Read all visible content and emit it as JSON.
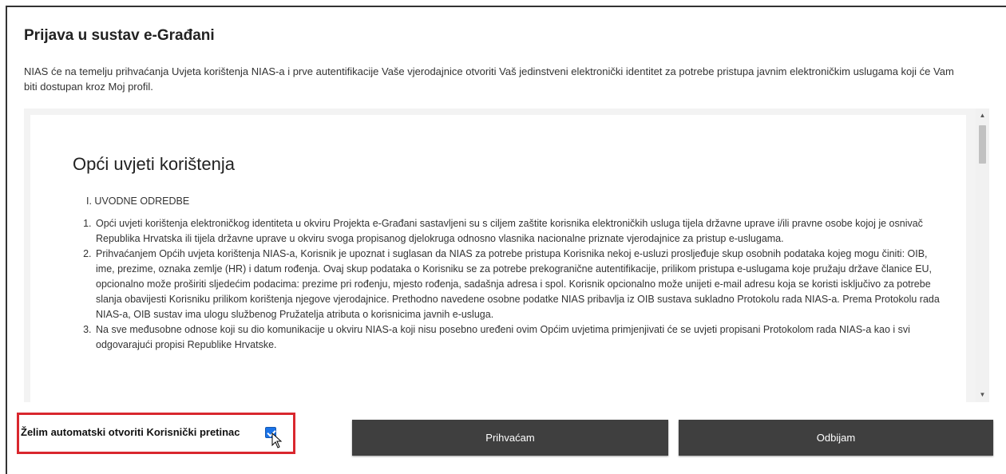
{
  "page": {
    "title": "Prijava u sustav e-Građani",
    "intro": "NIAS će na temelju prihvaćanja Uvjeta korištenja NIAS-a i prve autentifikacije Vaše vjerodajnice otvoriti Vaš jedinstveni elektronički identitet za potrebe pristupa javnim elektroničkim uslugama koji će Vam biti dostupan kroz Moj profil."
  },
  "terms": {
    "heading": "Opći uvjeti korištenja",
    "section_title": "I. UVODNE ODREDBE",
    "items": [
      "Opći uvjeti korištenja elektroničkog identiteta u okviru Projekta e-Građani sastavljeni su s ciljem zaštite korisnika elektroničkih usluga tijela državne uprave i/ili pravne osobe kojoj je osnivač Republika Hrvatska ili tijela državne uprave u okviru svoga propisanog djelokruga odnosno vlasnika nacionalne priznate vjerodajnice za pristup e-uslugama.",
      "Prihvaćanjem Općih uvjeta korištenja NIAS-a, Korisnik je upoznat i suglasan da NIAS za potrebe pristupa Korisnika nekoj e-usluzi prosljeđuje skup osobnih podataka kojeg mogu činiti: OIB, ime, prezime, oznaka zemlje (HR) i datum rođenja. Ovaj skup podataka o Korisniku se za potrebe prekogranične autentifikacije, prilikom pristupa e-uslugama koje pružaju države članice EU, opcionalno može proširiti sljedećim podacima: prezime pri rođenju, mjesto rođenja, sadašnja adresa i spol. Korisnik opcionalno može unijeti e-mail adresu koja se koristi isključivo za potrebe slanja obavijesti Korisniku prilikom korištenja njegove vjerodajnice. Prethodno navedene osobne podatke NIAS pribavlja iz OIB sustava sukladno Protokolu rada NIAS-a. Prema Protokolu rada NIAS-a, OIB sustav ima ulogu službenog Pružatelja atributa o korisnicima javnih e-usluga.",
      "Na sve međusobne odnose koji su dio komunikacije u okviru NIAS-a koji nisu posebno uređeni ovim Općim uvjetima primjenjivati će se uvjeti propisani Protokolom rada NIAS-a kao i svi odgovarajući propisi Republike Hrvatske."
    ]
  },
  "consent": {
    "label": "Želim automatski otvoriti Korisnički pretinac",
    "checked": true
  },
  "buttons": {
    "accept": "Prihvaćam",
    "reject": "Odbijam"
  },
  "colors": {
    "button_bg": "#3f3f3f",
    "highlight_border": "#d9272e",
    "checkbox": "#1a73e8"
  }
}
